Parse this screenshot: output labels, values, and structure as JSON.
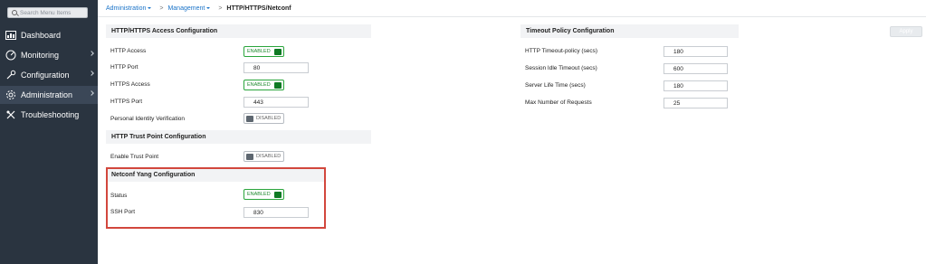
{
  "sidebar": {
    "search_placeholder": "Search Menu Items",
    "items": [
      {
        "label": "Dashboard",
        "icon": "dashboard-icon",
        "has_chevron": false,
        "active": false
      },
      {
        "label": "Monitoring",
        "icon": "monitoring-icon",
        "has_chevron": true,
        "active": false
      },
      {
        "label": "Configuration",
        "icon": "configuration-icon",
        "has_chevron": true,
        "active": false
      },
      {
        "label": "Administration",
        "icon": "administration-icon",
        "has_chevron": true,
        "active": true
      },
      {
        "label": "Troubleshooting",
        "icon": "troubleshooting-icon",
        "has_chevron": false,
        "active": false
      }
    ]
  },
  "breadcrumb": {
    "item1": "Administration",
    "item2": "Management",
    "separator": ">",
    "current": "HTTP/HTTPS/Netconf"
  },
  "apply_label": "Apply",
  "http_section": {
    "title": "HTTP/HTTPS Access Configuration",
    "http_access_label": "HTTP Access",
    "http_access_state": "ENABLED",
    "http_port_label": "HTTP Port",
    "http_port_value": "80",
    "https_access_label": "HTTPS Access",
    "https_access_state": "ENABLED",
    "https_port_label": "HTTPS Port",
    "https_port_value": "443",
    "piv_label": "Personal Identity Verification",
    "piv_state": "DISABLED"
  },
  "trust_section": {
    "title": "HTTP Trust Point Configuration",
    "enable_label": "Enable Trust Point",
    "enable_state": "DISABLED"
  },
  "netconf_section": {
    "title": "Netconf Yang Configuration",
    "status_label": "Status",
    "status_state": "ENABLED",
    "ssh_port_label": "SSH Port",
    "ssh_port_value": "830"
  },
  "timeout_section": {
    "title": "Timeout Policy Configuration",
    "http_timeout_label": "HTTP Timeout-policy (secs)",
    "http_timeout_value": "180",
    "session_idle_label": "Session Idle Timeout (secs)",
    "session_idle_value": "600",
    "server_life_label": "Server Life Time (secs)",
    "server_life_value": "180",
    "max_requests_label": "Max Number of Requests",
    "max_requests_value": "25"
  },
  "colors": {
    "sidebar_bg": "#2a3440",
    "active_item_bg": "#3b4757",
    "link_blue": "#1a73c8",
    "enabled_green": "#0f7a24",
    "highlight_red": "#d2473d"
  }
}
